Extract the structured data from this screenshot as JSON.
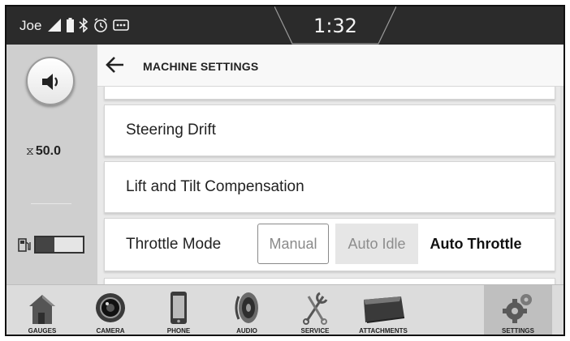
{
  "status_bar": {
    "user": "Joe",
    "clock": "1:32",
    "icons": [
      "signal-icon",
      "battery-icon",
      "bluetooth-icon",
      "clock-alarm-icon",
      "message-icon"
    ]
  },
  "sidebar": {
    "hour_meter_value": "50.0",
    "hour_meter_icon": "⧖",
    "fuel_level_percent": 40
  },
  "header": {
    "title": "MACHINE SETTINGS"
  },
  "settings": [
    {
      "label": "Steering Drift"
    },
    {
      "label": "Lift and Tilt Compensation"
    },
    {
      "label": "Throttle Mode",
      "options": [
        "Manual",
        "Auto Idle",
        "Auto Throttle"
      ],
      "selected": "Auto Throttle"
    }
  ],
  "bottom_nav": [
    {
      "id": "gauges",
      "label": "GAUGES"
    },
    {
      "id": "camera",
      "label": "CAMERA"
    },
    {
      "id": "phone",
      "label": "PHONE"
    },
    {
      "id": "audio",
      "label": "AUDIO"
    },
    {
      "id": "service",
      "label": "SERVICE"
    },
    {
      "id": "attachments",
      "label": "ATTACHMENTS"
    },
    {
      "id": "settings",
      "label": "SETTINGS",
      "active": true
    }
  ]
}
